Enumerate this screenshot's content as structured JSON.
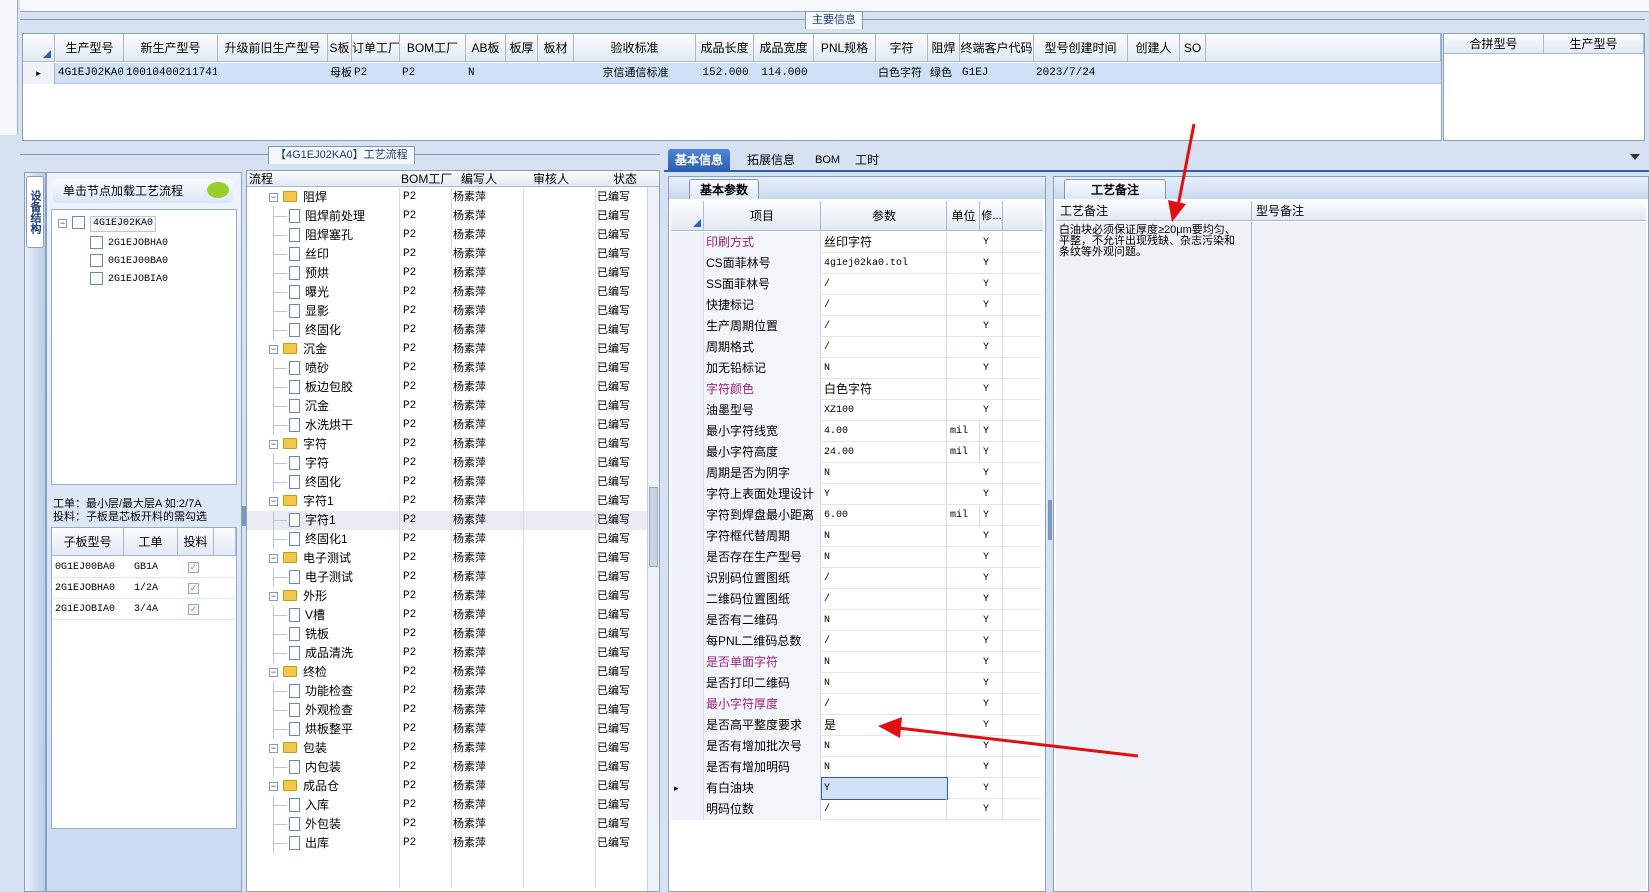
{
  "top": {
    "title": "主要信息",
    "columns": [
      "生产型号",
      "新生产型号",
      "升级前旧生产型号",
      "S板",
      "订单工厂",
      "BOM工厂",
      "AB板",
      "板厚",
      "板材",
      "验收标准",
      "成品长度",
      "成品宽度",
      "PNL规格",
      "字符",
      "阻焊",
      "终端客户代码",
      "型号创建时间",
      "创建人",
      "SO"
    ],
    "row": [
      "4G1EJ02KA0",
      "10010400211741",
      "",
      "母板",
      "P2",
      "P2",
      "N",
      "",
      "",
      "京信通信标准",
      "152.000",
      "114.000",
      "",
      "白色字符",
      "绿色",
      "G1EJ",
      "2023/7/24",
      "",
      ""
    ],
    "side_columns": [
      "合拼型号",
      "生产型号"
    ]
  },
  "left": {
    "vertical_tab": "设备结构",
    "load_hint": "单击节点加载工艺流程",
    "tree": [
      "4G1EJ02KA0",
      "2G1EJOBHA0",
      "0G1EJ00BA0",
      "2G1EJOBIA0"
    ],
    "note_line1": "工单：最小层/最大层A 如:2/7A",
    "note_line2": "投料：子板是芯板开料的需勾选",
    "sub_headers": [
      "子板型号",
      "工单",
      "投料"
    ],
    "sub_rows": [
      {
        "model": "0G1EJ00BA0",
        "order": "GB1A"
      },
      {
        "model": "2G1EJOBHA0",
        "order": "1/2A"
      },
      {
        "model": "2G1EJOBIA0",
        "order": "3/4A"
      }
    ]
  },
  "process": {
    "title": "【4G1EJ02KA0】工艺流程",
    "headers": [
      "流程",
      "BOM工厂",
      "编写人",
      "审核人",
      "状态"
    ],
    "rows": [
      {
        "name": "阻焊",
        "level": 0,
        "factory": "P2",
        "writer": "杨素萍",
        "status": "已编写"
      },
      {
        "name": "阻焊前处理",
        "level": 1,
        "factory": "P2",
        "writer": "杨素萍",
        "status": "已编写"
      },
      {
        "name": "阻焊塞孔",
        "level": 1,
        "factory": "P2",
        "writer": "杨素萍",
        "status": "已编写"
      },
      {
        "name": "丝印",
        "level": 1,
        "factory": "P2",
        "writer": "杨素萍",
        "status": "已编写"
      },
      {
        "name": "预烘",
        "level": 1,
        "factory": "P2",
        "writer": "杨素萍",
        "status": "已编写"
      },
      {
        "name": "曝光",
        "level": 1,
        "factory": "P2",
        "writer": "杨素萍",
        "status": "已编写"
      },
      {
        "name": "显影",
        "level": 1,
        "factory": "P2",
        "writer": "杨素萍",
        "status": "已编写"
      },
      {
        "name": "终固化",
        "level": 1,
        "factory": "P2",
        "writer": "杨素萍",
        "status": "已编写"
      },
      {
        "name": "沉金",
        "level": 0,
        "factory": "P2",
        "writer": "杨素萍",
        "status": "已编写"
      },
      {
        "name": "喷砂",
        "level": 1,
        "factory": "P2",
        "writer": "杨素萍",
        "status": "已编写"
      },
      {
        "name": "板边包胶",
        "level": 1,
        "factory": "P2",
        "writer": "杨素萍",
        "status": "已编写"
      },
      {
        "name": "沉金",
        "level": 1,
        "factory": "P2",
        "writer": "杨素萍",
        "status": "已编写"
      },
      {
        "name": "水洗烘干",
        "level": 1,
        "factory": "P2",
        "writer": "杨素萍",
        "status": "已编写"
      },
      {
        "name": "字符",
        "level": 0,
        "factory": "P2",
        "writer": "杨素萍",
        "status": "已编写"
      },
      {
        "name": "字符",
        "level": 1,
        "factory": "P2",
        "writer": "杨素萍",
        "status": "已编写"
      },
      {
        "name": "终固化",
        "level": 1,
        "factory": "P2",
        "writer": "杨素萍",
        "status": "已编写"
      },
      {
        "name": "字符1",
        "level": 0,
        "factory": "P2",
        "writer": "杨素萍",
        "status": "已编写"
      },
      {
        "name": "字符1",
        "level": 1,
        "factory": "P2",
        "writer": "杨素萍",
        "status": "已编写"
      },
      {
        "name": "终固化1",
        "level": 1,
        "factory": "P2",
        "writer": "杨素萍",
        "status": "已编写"
      },
      {
        "name": "电子测试",
        "level": 0,
        "factory": "P2",
        "writer": "杨素萍",
        "status": "已编写"
      },
      {
        "name": "电子测试",
        "level": 1,
        "factory": "P2",
        "writer": "杨素萍",
        "status": "已编写"
      },
      {
        "name": "外形",
        "level": 0,
        "factory": "P2",
        "writer": "杨素萍",
        "status": "已编写"
      },
      {
        "name": "V槽",
        "level": 1,
        "factory": "P2",
        "writer": "杨素萍",
        "status": "已编写"
      },
      {
        "name": "铣板",
        "level": 1,
        "factory": "P2",
        "writer": "杨素萍",
        "status": "已编写"
      },
      {
        "name": "成品清洗",
        "level": 1,
        "factory": "P2",
        "writer": "杨素萍",
        "status": "已编写"
      },
      {
        "name": "终检",
        "level": 0,
        "factory": "P2",
        "writer": "杨素萍",
        "status": "已编写"
      },
      {
        "name": "功能检查",
        "level": 1,
        "factory": "P2",
        "writer": "杨素萍",
        "status": "已编写"
      },
      {
        "name": "外观检查",
        "level": 1,
        "factory": "P2",
        "writer": "杨素萍",
        "status": "已编写"
      },
      {
        "name": "烘板整平",
        "level": 1,
        "factory": "P2",
        "writer": "杨素萍",
        "status": "已编写"
      },
      {
        "name": "包装",
        "level": 0,
        "factory": "P2",
        "writer": "杨素萍",
        "status": "已编写"
      },
      {
        "name": "内包装",
        "level": 1,
        "factory": "P2",
        "writer": "杨素萍",
        "status": "已编写"
      },
      {
        "name": "成品仓",
        "level": 0,
        "factory": "P2",
        "writer": "杨素萍",
        "status": "已编写"
      },
      {
        "name": "入库",
        "level": 1,
        "factory": "P2",
        "writer": "杨素萍",
        "status": "已编写"
      },
      {
        "name": "外包装",
        "level": 1,
        "factory": "P2",
        "writer": "杨素萍",
        "status": "已编写"
      },
      {
        "name": "出库",
        "level": 1,
        "factory": "P2",
        "writer": "杨素萍",
        "status": "已编写"
      }
    ]
  },
  "tabs": [
    "基本信息",
    "拓展信息",
    "BOM",
    "工时"
  ],
  "params": {
    "title": "基本参数",
    "headers": [
      "项目",
      "参数",
      "单位",
      "修..."
    ],
    "rows": [
      {
        "k": "印刷方式",
        "v": "丝印字符",
        "u": "",
        "m": "Y",
        "pink": true
      },
      {
        "k": "CS面菲林号",
        "v": "4g1ej02ka0.tol",
        "u": "",
        "m": "Y"
      },
      {
        "k": "SS面菲林号",
        "v": "/",
        "u": "",
        "m": "Y"
      },
      {
        "k": "快捷标记",
        "v": "/",
        "u": "",
        "m": "Y"
      },
      {
        "k": "生产周期位置",
        "v": "/",
        "u": "",
        "m": "Y"
      },
      {
        "k": "周期格式",
        "v": "/",
        "u": "",
        "m": "Y"
      },
      {
        "k": "加无铅标记",
        "v": "N",
        "u": "",
        "m": "Y"
      },
      {
        "k": "字符颜色",
        "v": "白色字符",
        "u": "",
        "m": "Y",
        "pink": true
      },
      {
        "k": "油墨型号",
        "v": "XZ100",
        "u": "",
        "m": "Y"
      },
      {
        "k": "最小字符线宽",
        "v": "4.00",
        "u": "mil",
        "m": "Y"
      },
      {
        "k": "最小字符高度",
        "v": "24.00",
        "u": "mil",
        "m": "Y"
      },
      {
        "k": "周期是否为阴字",
        "v": "N",
        "u": "",
        "m": "Y"
      },
      {
        "k": "字符上表面处理设计",
        "v": "Y",
        "u": "",
        "m": "Y"
      },
      {
        "k": "字符到焊盘最小距离",
        "v": "6.00",
        "u": "mil",
        "m": "Y"
      },
      {
        "k": "字符框代替周期",
        "v": "N",
        "u": "",
        "m": "Y"
      },
      {
        "k": "是否存在生产型号",
        "v": "N",
        "u": "",
        "m": "Y"
      },
      {
        "k": "识别码位置图纸",
        "v": "/",
        "u": "",
        "m": "Y"
      },
      {
        "k": "二维码位置图纸",
        "v": "/",
        "u": "",
        "m": "Y"
      },
      {
        "k": "是否有二维码",
        "v": "N",
        "u": "",
        "m": "Y"
      },
      {
        "k": "每PNL二维码总数",
        "v": "/",
        "u": "",
        "m": "Y"
      },
      {
        "k": "是否单面字符",
        "v": "N",
        "u": "",
        "m": "Y",
        "pink": true
      },
      {
        "k": "是否打印二维码",
        "v": "N",
        "u": "",
        "m": "Y"
      },
      {
        "k": "最小字符厚度",
        "v": "/",
        "u": "",
        "m": "Y",
        "pink": true
      },
      {
        "k": "是否高平整度要求",
        "v": "是",
        "u": "",
        "m": "Y"
      },
      {
        "k": "是否有增加批次号",
        "v": "N",
        "u": "",
        "m": "Y"
      },
      {
        "k": "是否有增加明码",
        "v": "N",
        "u": "",
        "m": "Y"
      },
      {
        "k": "有白油块",
        "v": "Y",
        "u": "",
        "m": "Y",
        "selected": true
      },
      {
        "k": "明码位数",
        "v": "/",
        "u": "",
        "m": "Y"
      }
    ]
  },
  "remarks": {
    "tab": "工艺备注",
    "col1": "工艺备注",
    "col2": "型号备注",
    "text": "白油块必须保证厚度≥20μm要均匀、平整，不允许出现残缺、杂志污染和条纹等外观问题。"
  },
  "colors": {
    "accent": "#2a5fb4",
    "selected_row": "#cfe0f7",
    "annotation_arrow": "#e01010",
    "link_pink": "#a0207e"
  }
}
